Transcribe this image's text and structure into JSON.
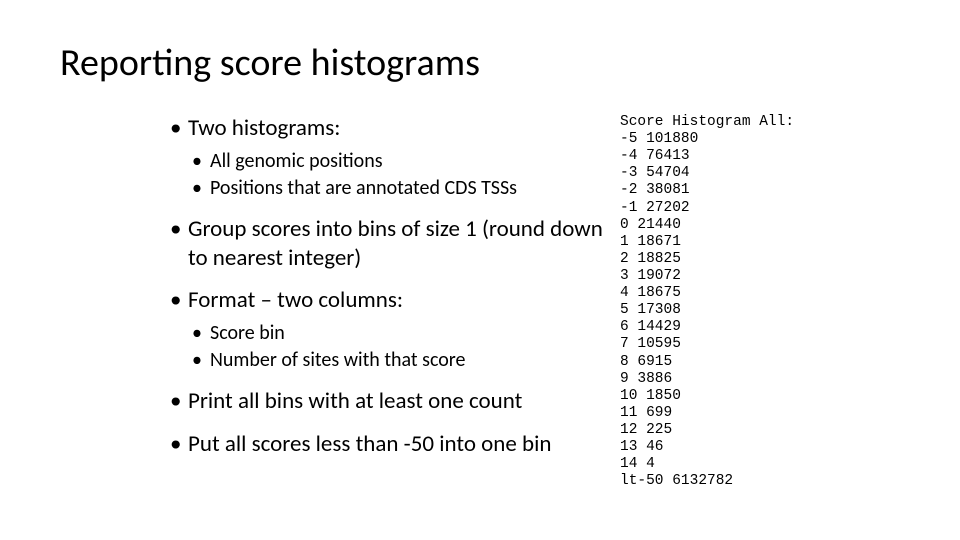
{
  "title": "Reporting score histograms",
  "bullets": {
    "b0": "Two histograms:",
    "b0_sub0": "All genomic positions",
    "b0_sub1": "Positions that are annotated CDS TSSs",
    "b1": "Group scores into bins of size 1 (round down to nearest integer)",
    "b2": "Format – two columns:",
    "b2_sub0": "Score bin",
    "b2_sub1": "Number of sites with that score",
    "b3": "Print all bins with at least one count",
    "b4": "Put all scores less than -50 into one bin"
  },
  "histogram": {
    "header": "Score Histogram All:",
    "rows": [
      "-5 101880",
      "-4 76413",
      "-3 54704",
      "-2 38081",
      "-1 27202",
      "0 21440",
      "1 18671",
      "2 18825",
      "3 19072",
      "4 18675",
      "5 17308",
      "6 14429",
      "7 10595",
      "8 6915",
      "9 3886",
      "10 1850",
      "11 699",
      "12 225",
      "13 46",
      "14 4",
      "lt-50 6132782"
    ]
  }
}
